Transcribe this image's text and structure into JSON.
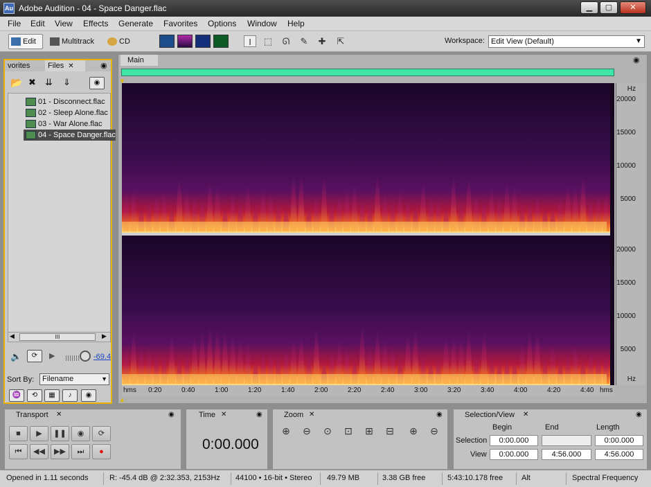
{
  "window": {
    "title": "Adobe Audition - 04 - Space Danger.flac",
    "app_icon": "Au",
    "min": "▁",
    "max": "▢",
    "close": "✕"
  },
  "menu": [
    "File",
    "Edit",
    "View",
    "Effects",
    "Generate",
    "Favorites",
    "Options",
    "Window",
    "Help"
  ],
  "toolbar": {
    "edit": "Edit",
    "multitrack": "Multitrack",
    "cd": "CD",
    "workspace_label": "Workspace:",
    "workspace_value": "Edit View (Default)"
  },
  "left_panel": {
    "tabs": [
      "vorites",
      "Files"
    ],
    "files": [
      "01 - Disconnect.flac",
      "02 - Sleep Alone.flac",
      "03 - War Alone.flac",
      "04 - Space Danger.flac"
    ],
    "scroll_thumb": "III",
    "volume": "-69.4",
    "sort_label": "Sort By:",
    "sort_value": "Filename"
  },
  "main": {
    "tab": "Main",
    "hz_unit": "Hz",
    "hz_ticks": [
      "20000",
      "15000",
      "10000",
      "5000"
    ],
    "time_unit": "hms",
    "time_ticks": [
      "0:20",
      "0:40",
      "1:00",
      "1:20",
      "1:40",
      "2:00",
      "2:20",
      "2:40",
      "3:00",
      "3:20",
      "3:40",
      "4:00",
      "4:20",
      "4:40"
    ]
  },
  "transport": {
    "title": "Transport"
  },
  "time_panel": {
    "title": "Time",
    "value": "0:00.000"
  },
  "zoom_panel": {
    "title": "Zoom"
  },
  "selection_view": {
    "title": "Selection/View",
    "headers": [
      "Begin",
      "End",
      "Length"
    ],
    "selection_label": "Selection",
    "view_label": "View",
    "selection": [
      "0:00.000",
      "",
      "0:00.000"
    ],
    "view": [
      "0:00.000",
      "4:56.000",
      "4:56.000"
    ]
  },
  "status": {
    "opened": "Opened in 1.11 seconds",
    "cursor": "R: -45.4 dB @   2:32.353, 2153Hz",
    "format": "44100 • 16-bit • Stereo",
    "size": "49.79 MB",
    "free": "3.38 GB free",
    "time_free": "5:43:10.178 free",
    "alt": "Alt",
    "view": "Spectral Frequency"
  }
}
